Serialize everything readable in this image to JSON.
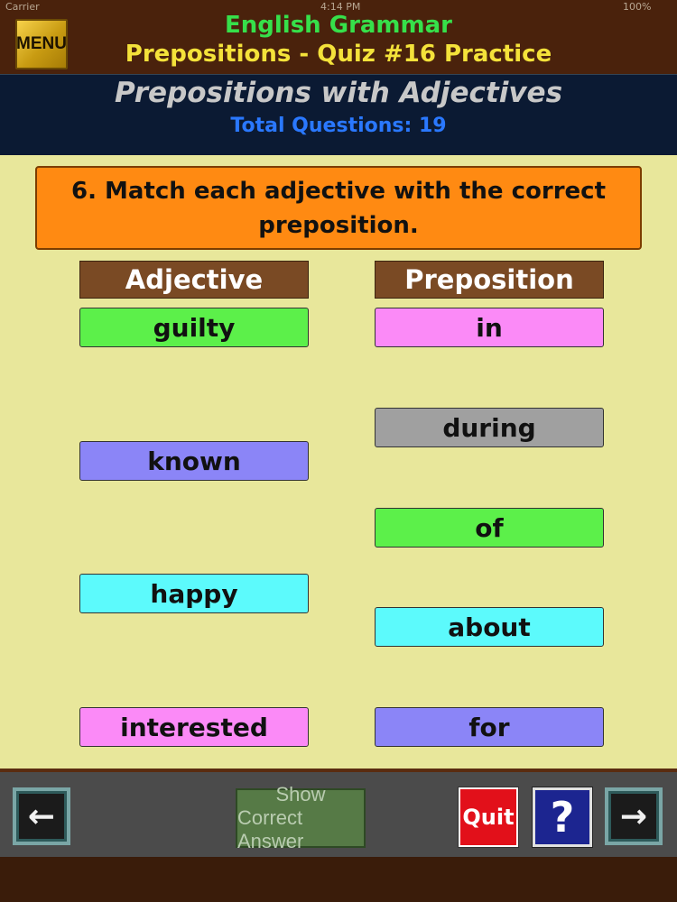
{
  "status_bar": {
    "carrier": "Carrier",
    "time": "4:14 PM",
    "battery": "100%"
  },
  "header": {
    "menu_label": "MENU",
    "title_line1": "English Grammar",
    "title_line2": "Prepositions - Quiz #16 Practice"
  },
  "subheader": {
    "topic": "Prepositions with Adjectives",
    "total_questions": "Total Questions: 19"
  },
  "question": {
    "text": "6. Match each adjective with the correct preposition."
  },
  "columns": {
    "left_header": "Adjective",
    "right_header": "Preposition"
  },
  "adjectives": [
    {
      "label": "guilty",
      "color": "#5cf04a"
    },
    {
      "label": "known",
      "color": "#8b85f7"
    },
    {
      "label": "happy",
      "color": "#5cfafc"
    },
    {
      "label": "interested",
      "color": "#fb8af7"
    }
  ],
  "prepositions": [
    {
      "label": "in",
      "color": "#fb8af7"
    },
    {
      "label": "during",
      "color": "#a0a0a0"
    },
    {
      "label": "of",
      "color": "#5cf04a"
    },
    {
      "label": "about",
      "color": "#5cfafc"
    },
    {
      "label": "for",
      "color": "#8b85f7"
    }
  ],
  "footer": {
    "back_icon": "left-arrow-icon",
    "show_answer_line1": "Show",
    "show_answer_line2": "Correct Answer",
    "quit_label": "Quit",
    "help_label": "?",
    "next_icon": "right-arrow-icon"
  }
}
